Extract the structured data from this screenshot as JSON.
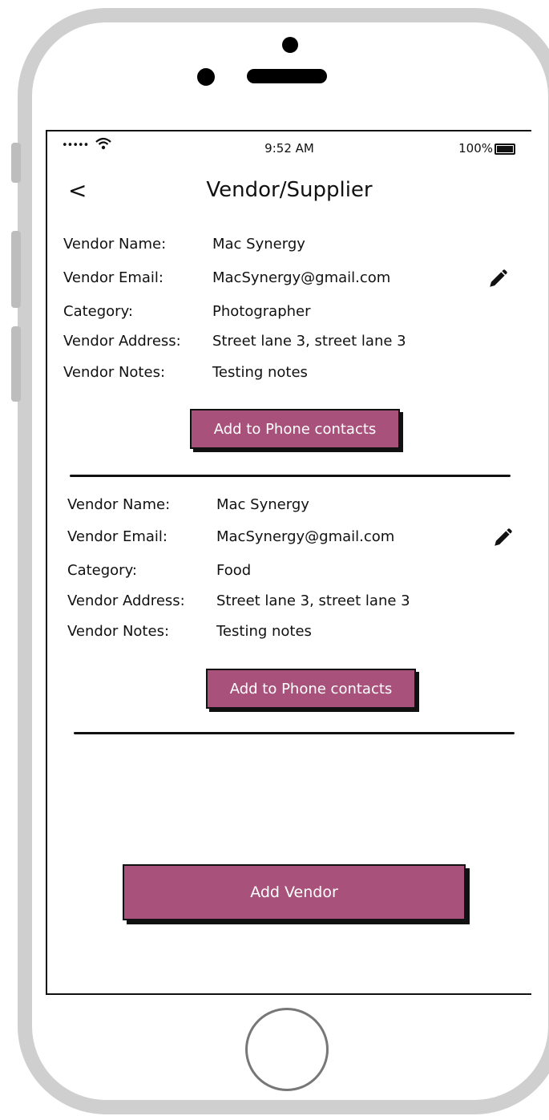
{
  "status_bar": {
    "signal": "•••••",
    "time": "9:52 AM",
    "battery": "100%"
  },
  "nav": {
    "back_label": "<",
    "title": "Vendor/Supplier"
  },
  "vendors": [
    {
      "name_label": "Vendor Name:",
      "name": "Mac Synergy",
      "email_label": "Vendor Email:",
      "email": "MacSynergy@gmail.com",
      "category_label": "Category:",
      "category": "Photographer",
      "address_label": "Vendor Address:",
      "address": "Street lane 3, street lane 3",
      "notes_label": "Vendor Notes:",
      "notes": "Testing notes",
      "action_label": "Add  to Phone contacts"
    },
    {
      "name_label": "Vendor Name:",
      "name": "Mac Synergy",
      "email_label": "Vendor Email:",
      "email": "MacSynergy@gmail.com",
      "category_label": "Category:",
      "category": "Food",
      "address_label": "Vendor Address:",
      "address": "Street lane 3, street lane 3",
      "notes_label": "Vendor Notes:",
      "notes": "Testing notes",
      "action_label": "Add  to Phone contacts"
    }
  ],
  "footer": {
    "add_vendor_label": "Add Vendor"
  },
  "colors": {
    "accent": "#a8527b",
    "frame": "#cfcfcf",
    "ink": "#111111"
  },
  "icons": [
    "wifi-icon",
    "battery-icon",
    "back-icon",
    "pencil-icon",
    "home-button"
  ]
}
